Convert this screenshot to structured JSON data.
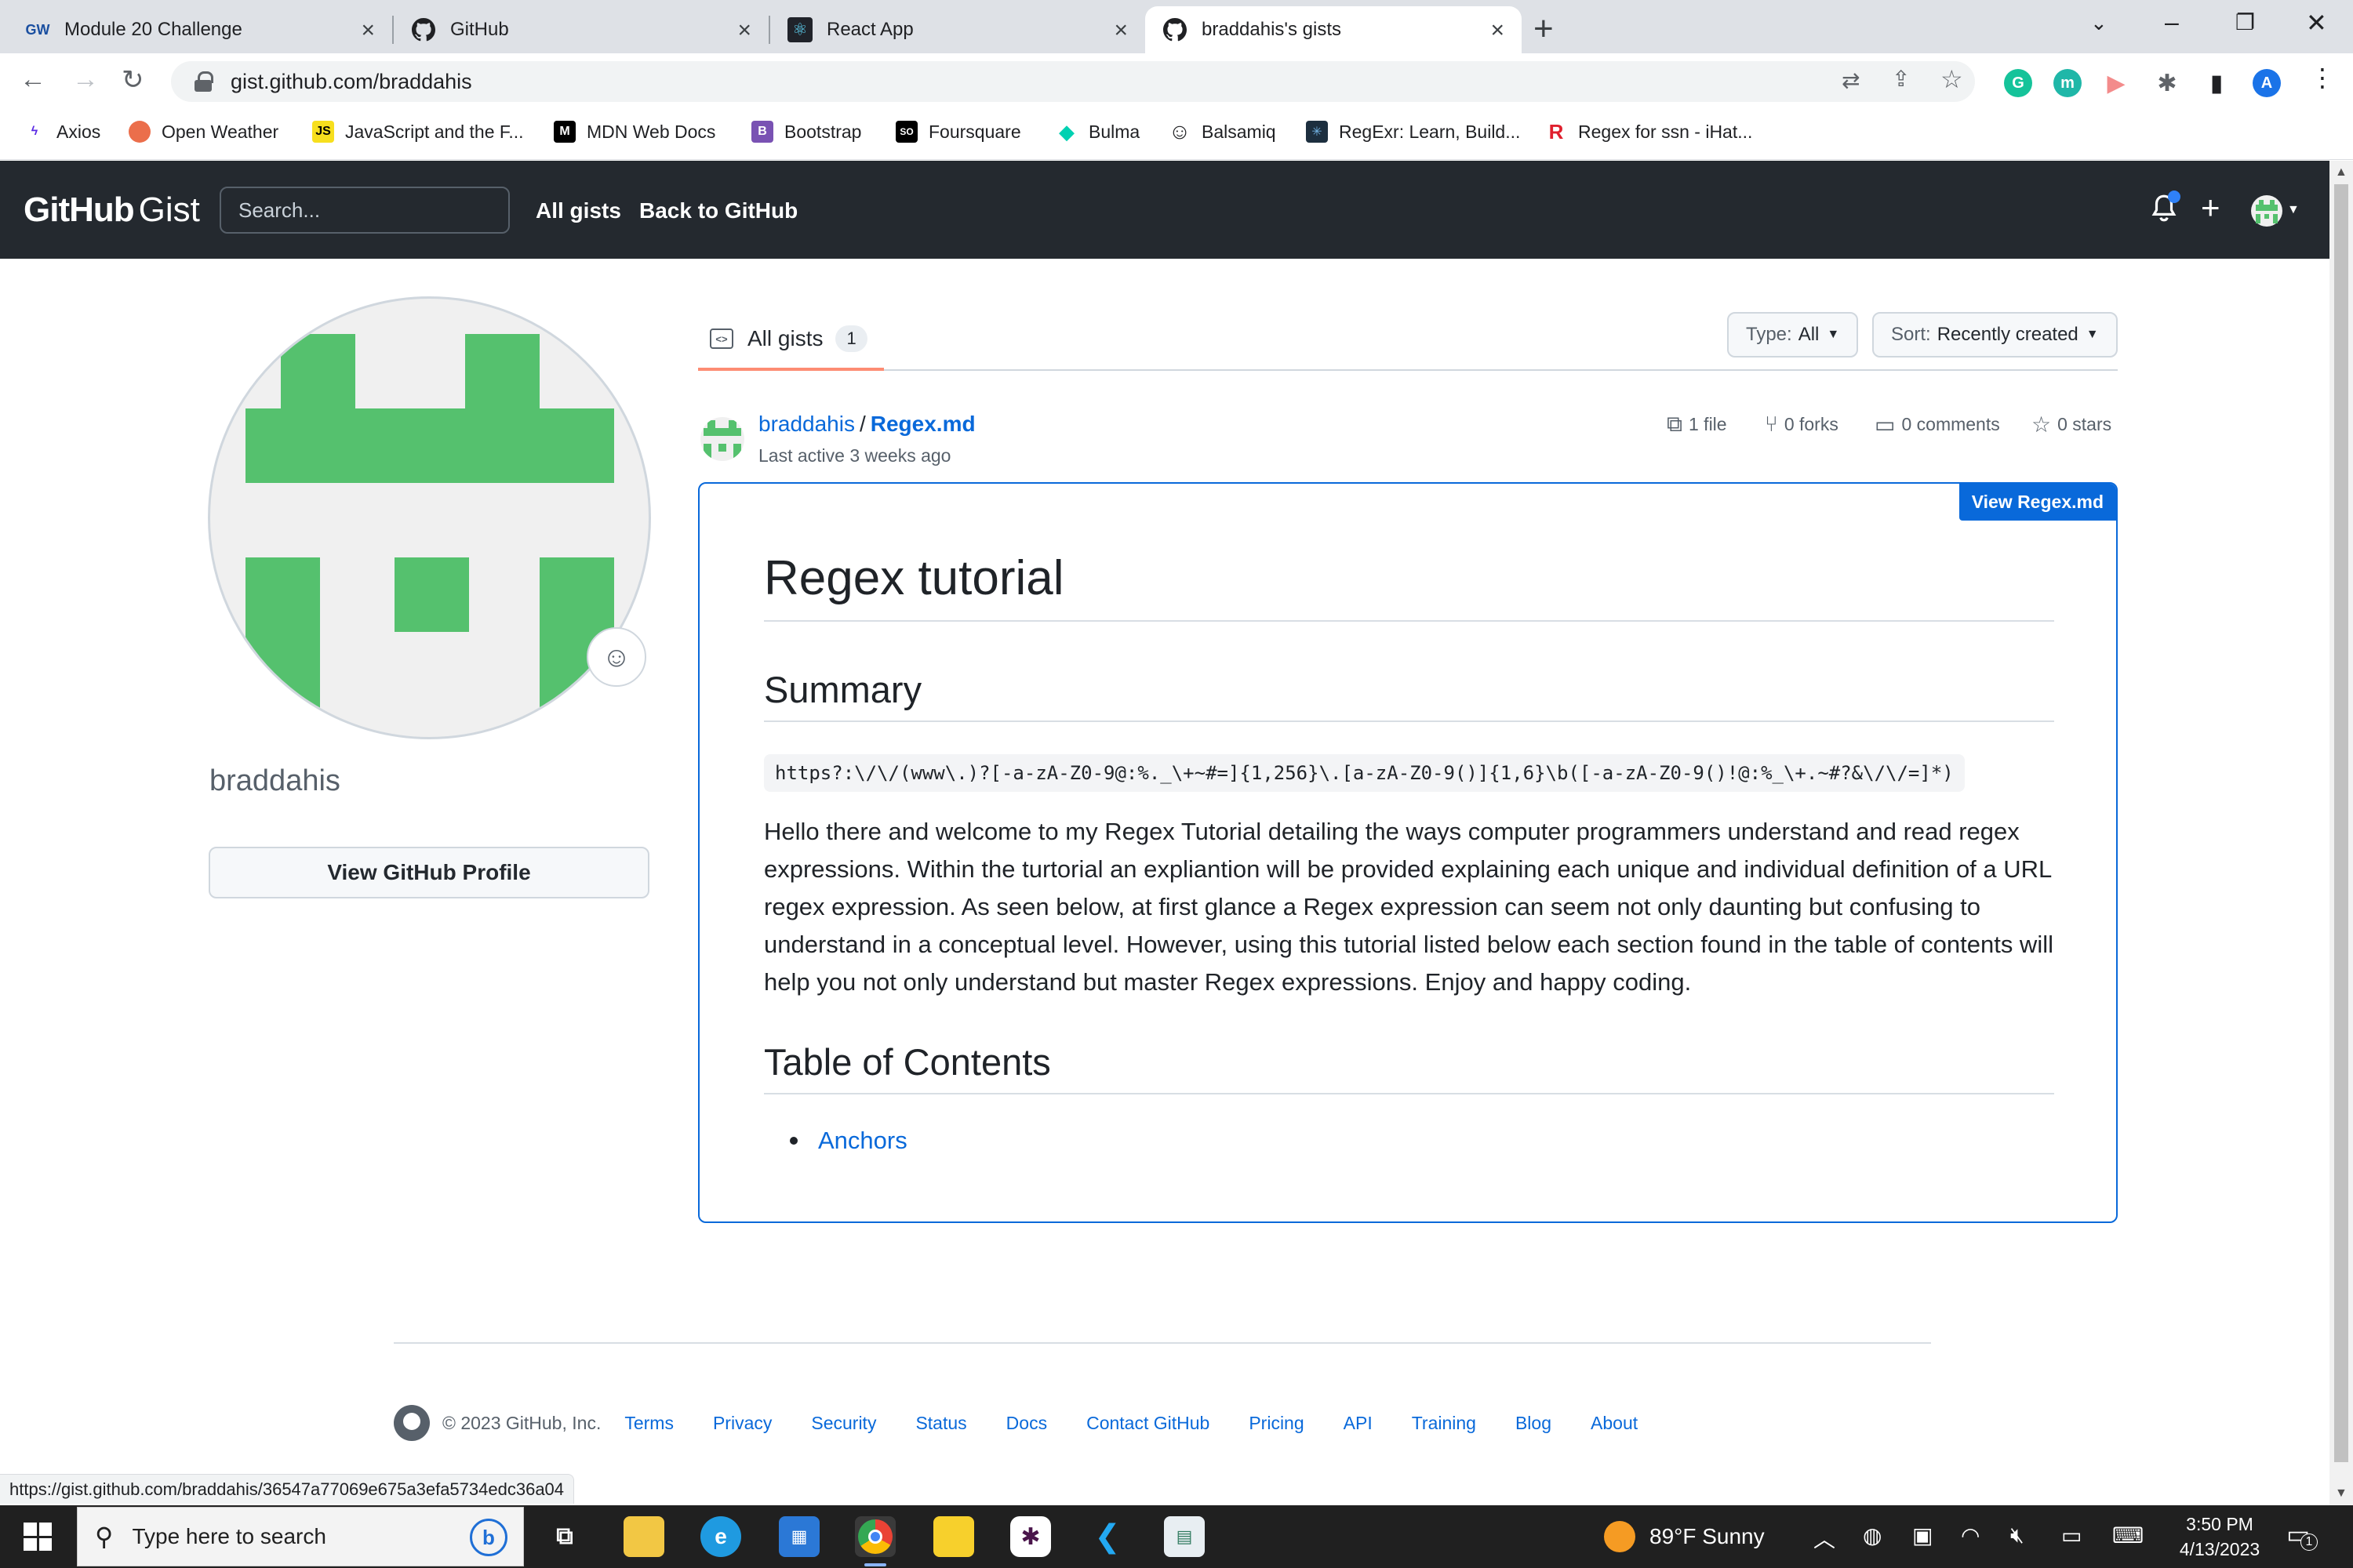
{
  "browser": {
    "tabs": [
      {
        "favicon": "GW",
        "label": "Module 20 Challenge"
      },
      {
        "favicon": "github-icon",
        "label": "GitHub"
      },
      {
        "favicon": "react-icon",
        "label": "React App"
      },
      {
        "favicon": "github-icon",
        "label": "braddahis's gists"
      }
    ],
    "url": "gist.github.com/braddahis",
    "profile_initial": "A",
    "bookmarks": [
      "Axios",
      "Open Weather",
      "JavaScript and the F...",
      "MDN Web Docs",
      "Bootstrap",
      "Foursquare",
      "Bulma",
      "Balsamiq",
      "RegExr: Learn, Build...",
      "Regex for ssn - iHat..."
    ],
    "bookmark_icons": [
      "JS",
      "M",
      "B",
      "SO",
      "R"
    ],
    "status_url": "https://gist.github.com/braddahis/36547a77069e675a3efa5734edc36a04"
  },
  "header": {
    "logo_bold": "GitHub",
    "logo_light": "Gist",
    "search_placeholder": "Search...",
    "nav": [
      "All gists",
      "Back to GitHub"
    ]
  },
  "profile": {
    "username": "braddahis",
    "view_profile_label": "View GitHub Profile"
  },
  "gists": {
    "tab_label": "All gists",
    "tab_count": "1",
    "type_filter": {
      "label": "Type:",
      "value": "All"
    },
    "sort_filter": {
      "label": "Sort:",
      "value": "Recently created"
    },
    "item": {
      "owner": "braddahis",
      "filename": "Regex.md",
      "last_active": "Last active 3 weeks ago",
      "files": "1 file",
      "forks": "0 forks",
      "comments": "0 comments",
      "stars": "0 stars",
      "view_label": "View Regex.md",
      "content": {
        "h1": "Regex tutorial",
        "h2_summary": "Summary",
        "code": "https?:\\/\\/(www\\.)?[-a-zA-Z0-9@:%._\\+~#=]{1,256}\\.[a-zA-Z0-9()]{1,6}\\b([-a-zA-Z0-9()!@:%_\\+.~#?&\\/\\/=]*)",
        "paragraph": "Hello there and welcome to my Regex Tutorial detailing the ways computer programmers understand and read regex expressions. Within the turtorial an expliantion will be provided explaining each unique and individual definition of a URL regex expression. As seen below, at first glance a Regex expression can seem not only daunting but confusing to understand in a conceptual level. However, using this tutorial listed below each section found in the table of contents will help you not only understand but master Regex expressions. Enjoy and happy coding.",
        "h2_toc": "Table of Contents",
        "toc_items": [
          "Anchors"
        ]
      }
    }
  },
  "footer": {
    "copyright": "© 2023 GitHub, Inc.",
    "links": [
      "Terms",
      "Privacy",
      "Security",
      "Status",
      "Docs",
      "Contact GitHub",
      "Pricing",
      "API",
      "Training",
      "Blog",
      "About"
    ]
  },
  "taskbar": {
    "search_placeholder": "Type here to search",
    "weather": "89°F  Sunny",
    "time": "3:50 PM",
    "date": "4/13/2023",
    "notification_count": "1"
  },
  "colors": {
    "gh_header": "#24292f",
    "link": "#0969da",
    "avatar_green": "#55c16e",
    "tab_underline": "#fd8c73"
  }
}
